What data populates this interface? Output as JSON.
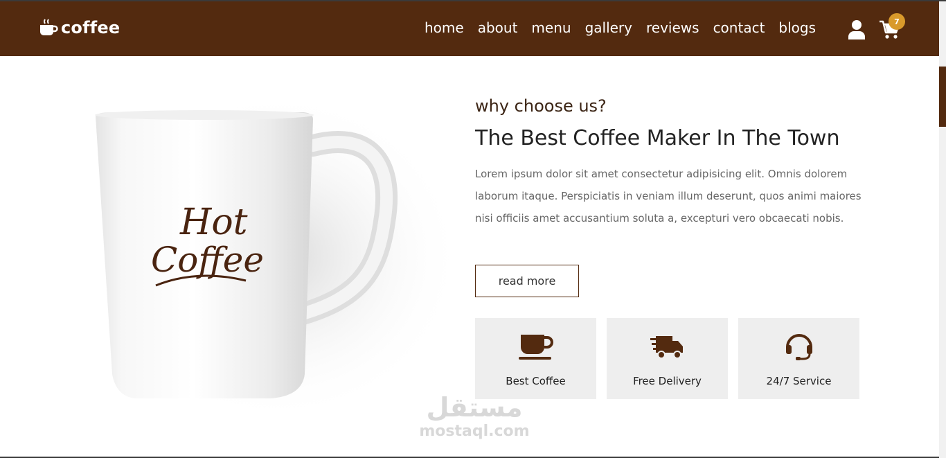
{
  "header": {
    "logo_text": "coffee",
    "logo_icon": "mug-hot-icon",
    "nav": [
      {
        "label": "home"
      },
      {
        "label": "about"
      },
      {
        "label": "menu"
      },
      {
        "label": "gallery"
      },
      {
        "label": "reviews"
      },
      {
        "label": "contact"
      },
      {
        "label": "blogs"
      }
    ],
    "cart_count": "7",
    "user_icon": "user-icon",
    "cart_icon": "shopping-cart-icon"
  },
  "hero": {
    "mug_text_line1": "Hot",
    "mug_text_line2": "Coffee",
    "subtitle": "why choose us?",
    "title": "The Best Coffee Maker In The Town",
    "paragraph": "Lorem ipsum dolor sit amet consectetur adipisicing elit. Omnis dolorem laborum itaque. Perspiciatis in veniam illum deserunt, quos animi maiores nisi officiis amet accusantium soluta a, excepturi vero obcaecati nobis.",
    "read_more": "read more"
  },
  "features": [
    {
      "label": "Best Coffee",
      "icon": "coffee-cup-icon"
    },
    {
      "label": "Free Delivery",
      "icon": "shipping-fast-icon"
    },
    {
      "label": "24/7 Service",
      "icon": "headset-icon"
    }
  ],
  "watermark": {
    "arabic": "مستقل",
    "latin": "mostaql.com"
  },
  "colors": {
    "brand": "#532a0f",
    "badge": "#d99a2b",
    "feature_bg": "#eeeeee"
  }
}
